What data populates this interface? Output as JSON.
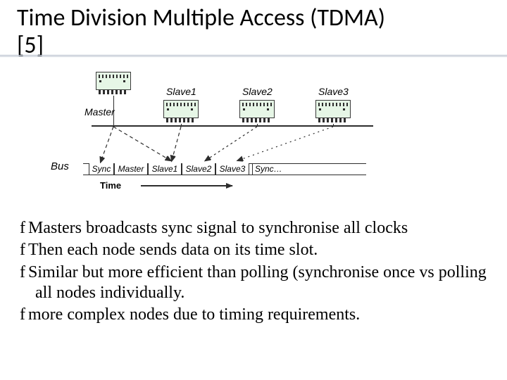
{
  "title_line1": "Time Division Multiple Access (TDMA)",
  "title_line2": "[5]",
  "diagram": {
    "master_label": "Master",
    "slave_labels": [
      "Slave1",
      "Slave2",
      "Slave3"
    ],
    "bus_label": "Bus",
    "time_label": "Time",
    "slots": [
      "Sync",
      "Master",
      "Slave1",
      "Slave2",
      "Slave3",
      "Sync…"
    ]
  },
  "bullets": [
    "Masters broadcasts sync signal to synchronise all clocks",
    "Then each node sends data on its time slot.",
    "Similar but more efficient than polling (synchronise once vs polling all nodes individually.",
    "more complex nodes due to timing requirements."
  ],
  "bullet_glyph": "f"
}
